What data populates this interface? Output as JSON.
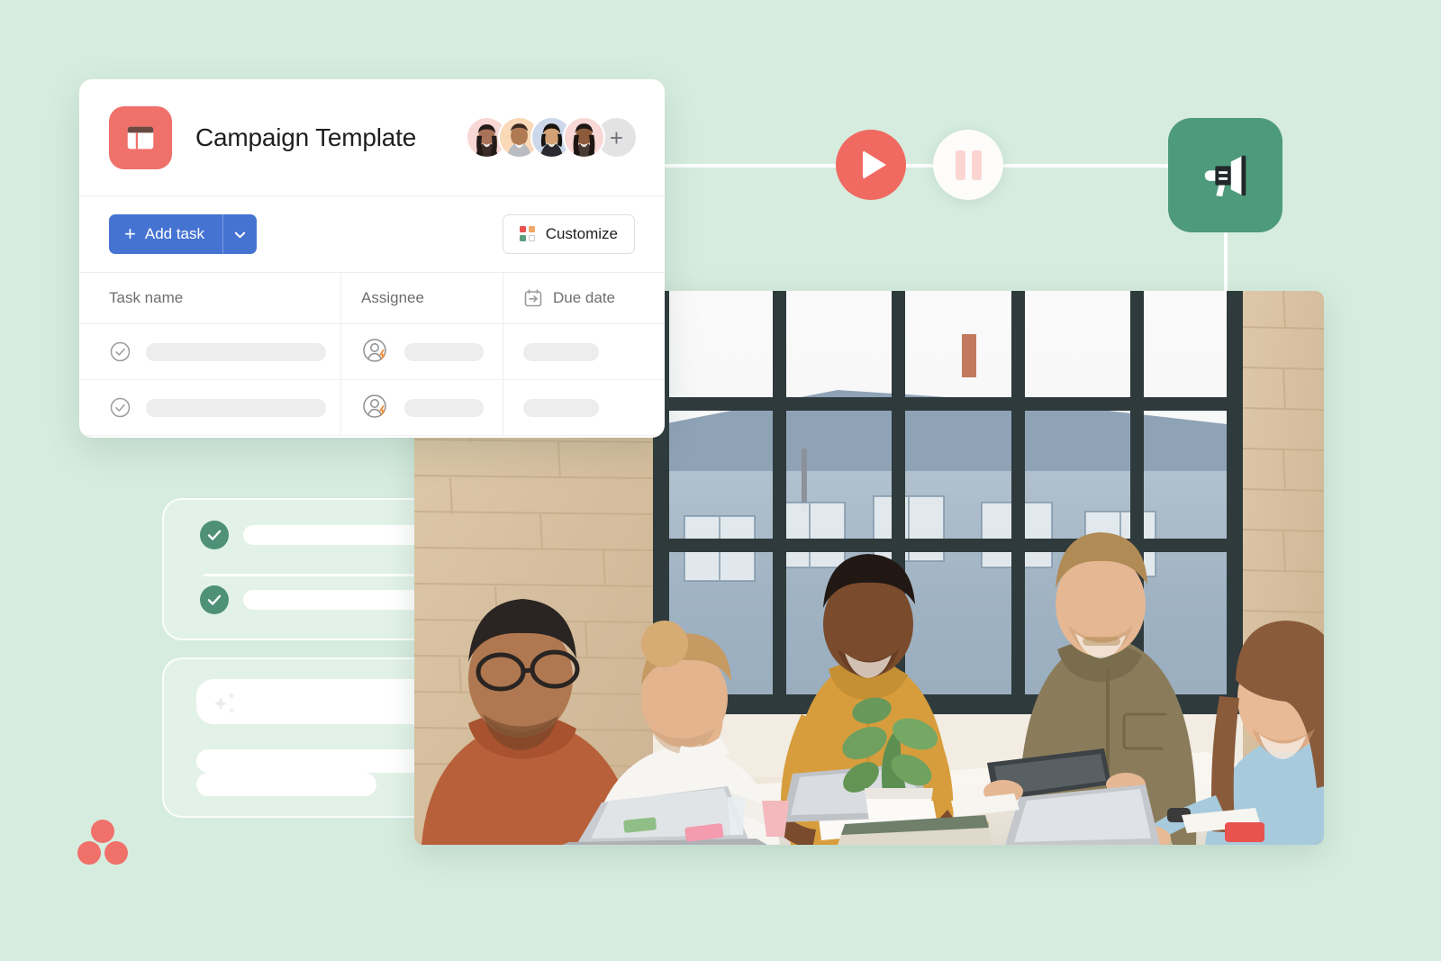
{
  "theme": {
    "background": "#d6ecdf",
    "accent_blue": "#4573d2",
    "accent_red": "#f0706a",
    "accent_green": "#4e9a7c",
    "check_green": "#4e9178",
    "pause_bar": "#fbd5d2"
  },
  "app_card": {
    "icon_name": "board-template-icon",
    "title": "Campaign Template",
    "avatars": [
      {
        "name": "avatar-member-1",
        "bg": "#f8d7d4"
      },
      {
        "name": "avatar-member-2",
        "bg": "#f9d9b8"
      },
      {
        "name": "avatar-member-3",
        "bg": "#ccd7ea"
      },
      {
        "name": "avatar-member-4",
        "bg": "#f8d7d4"
      }
    ],
    "add_member_label": "+",
    "toolbar": {
      "add_task_label": "Add task",
      "add_task_plus": "+",
      "customize_label": "Customize",
      "customize_swatches": [
        "#e8524f",
        "#f0a868",
        "#5a9e7e",
        "#ffffff"
      ]
    },
    "table": {
      "columns": [
        {
          "key": "task_name",
          "label": "Task name",
          "icon": null
        },
        {
          "key": "assignee",
          "label": "Assignee",
          "icon": null
        },
        {
          "key": "due_date",
          "label": "Due date",
          "icon": "calendar-arrow-icon"
        }
      ],
      "rows": [
        {
          "task_name": "",
          "assignee": "",
          "due_date": ""
        },
        {
          "task_name": "",
          "assignee": "",
          "due_date": ""
        }
      ]
    }
  },
  "timeline": {
    "play_button": {
      "name": "play-button",
      "icon": "play-icon"
    },
    "pause_button": {
      "name": "pause-button",
      "icon": "pause-icon"
    },
    "destination_tile": {
      "name": "megaphone-tile",
      "icon": "megaphone-icon"
    }
  },
  "ghost_cards": [
    {
      "name": "ghost-card-checklist",
      "rows": [
        {
          "checked": true
        },
        {
          "checked": true
        }
      ]
    },
    {
      "name": "ghost-card-ai",
      "icon": "sparkle-icon",
      "bars": 3
    }
  ],
  "photo": {
    "name": "team-meeting-photo",
    "alt": "Five colleagues collaborating around a table in a brick-walled loft office with large industrial windows, laptops and a potted plant on the table"
  },
  "brand": {
    "logo_name": "asana-logo-dots",
    "dot_color": "#f0706a"
  }
}
